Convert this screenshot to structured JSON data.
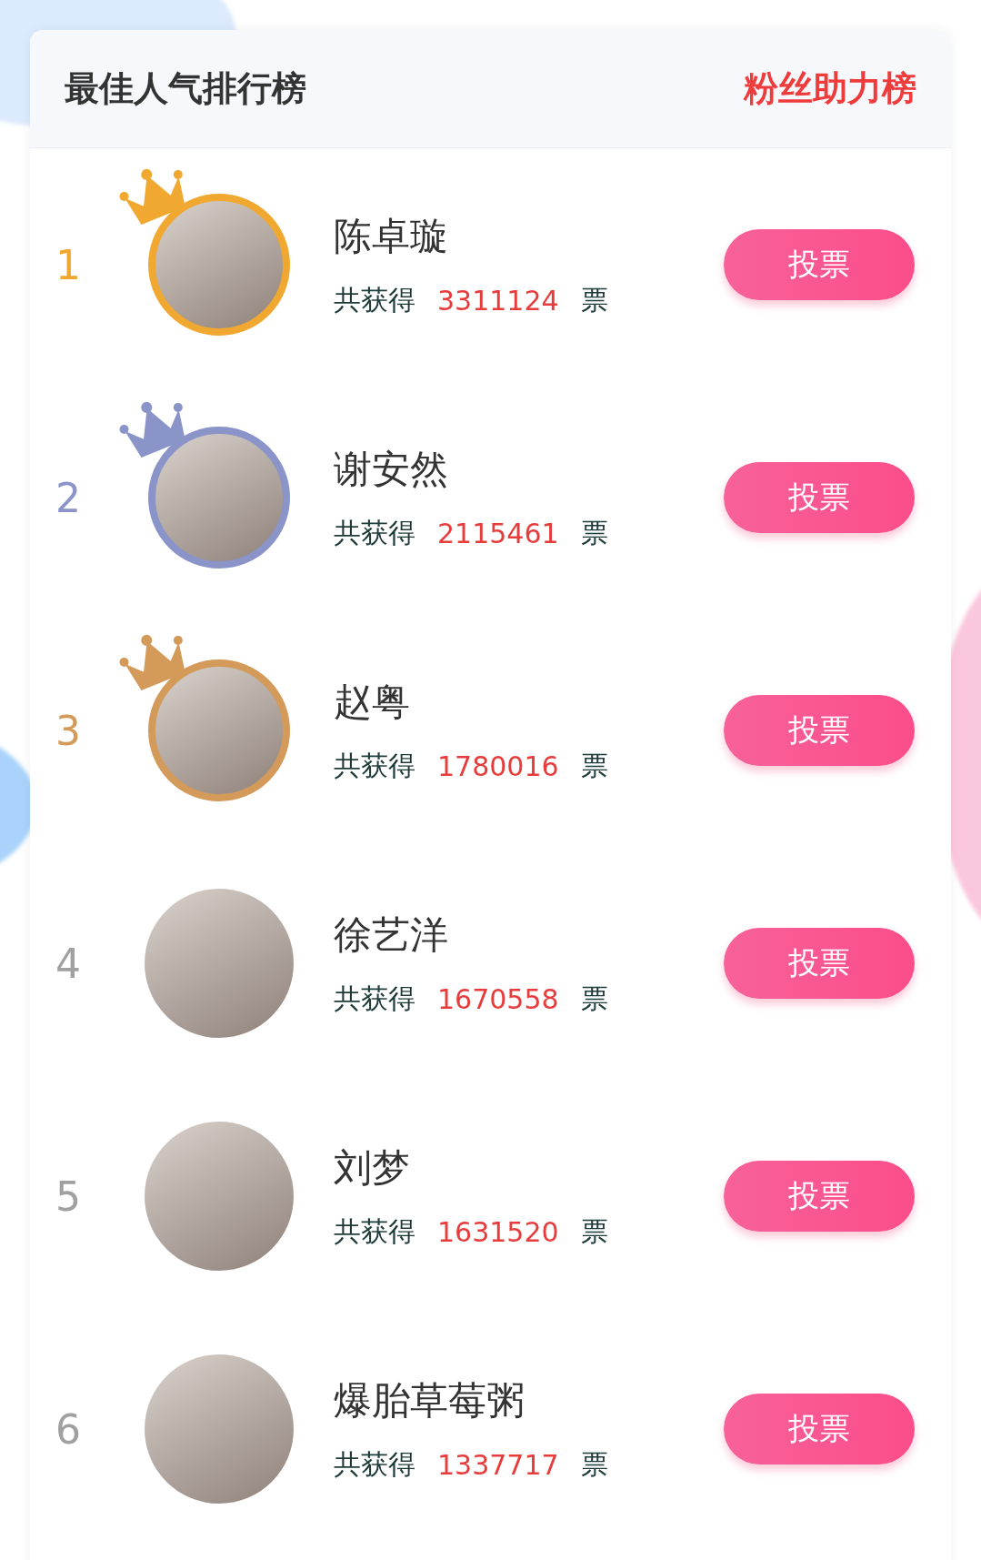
{
  "header": {
    "title": "最佳人气排行榜",
    "link": "粉丝助力榜"
  },
  "ranking": [
    {
      "rank": "1",
      "name": "陈卓璇",
      "prefix": "共获得",
      "votes": "3311124",
      "unit": "票",
      "button": "投票",
      "crowned": true,
      "color": "#f0a830"
    },
    {
      "rank": "2",
      "name": "谢安然",
      "prefix": "共获得",
      "votes": "2115461",
      "unit": "票",
      "button": "投票",
      "crowned": true,
      "color": "#8a94c8"
    },
    {
      "rank": "3",
      "name": "赵粤",
      "prefix": "共获得",
      "votes": "1780016",
      "unit": "票",
      "button": "投票",
      "crowned": true,
      "color": "#d49a5a"
    },
    {
      "rank": "4",
      "name": "徐艺洋",
      "prefix": "共获得",
      "votes": "1670558",
      "unit": "票",
      "button": "投票",
      "crowned": false,
      "color": "#a0a0a0"
    },
    {
      "rank": "5",
      "name": "刘梦",
      "prefix": "共获得",
      "votes": "1631520",
      "unit": "票",
      "button": "投票",
      "crowned": false,
      "color": "#a0a0a0"
    },
    {
      "rank": "6",
      "name": "爆胎草莓粥",
      "prefix": "共获得",
      "votes": "1337717",
      "unit": "票",
      "button": "投票",
      "crowned": false,
      "color": "#a0a0a0"
    }
  ]
}
